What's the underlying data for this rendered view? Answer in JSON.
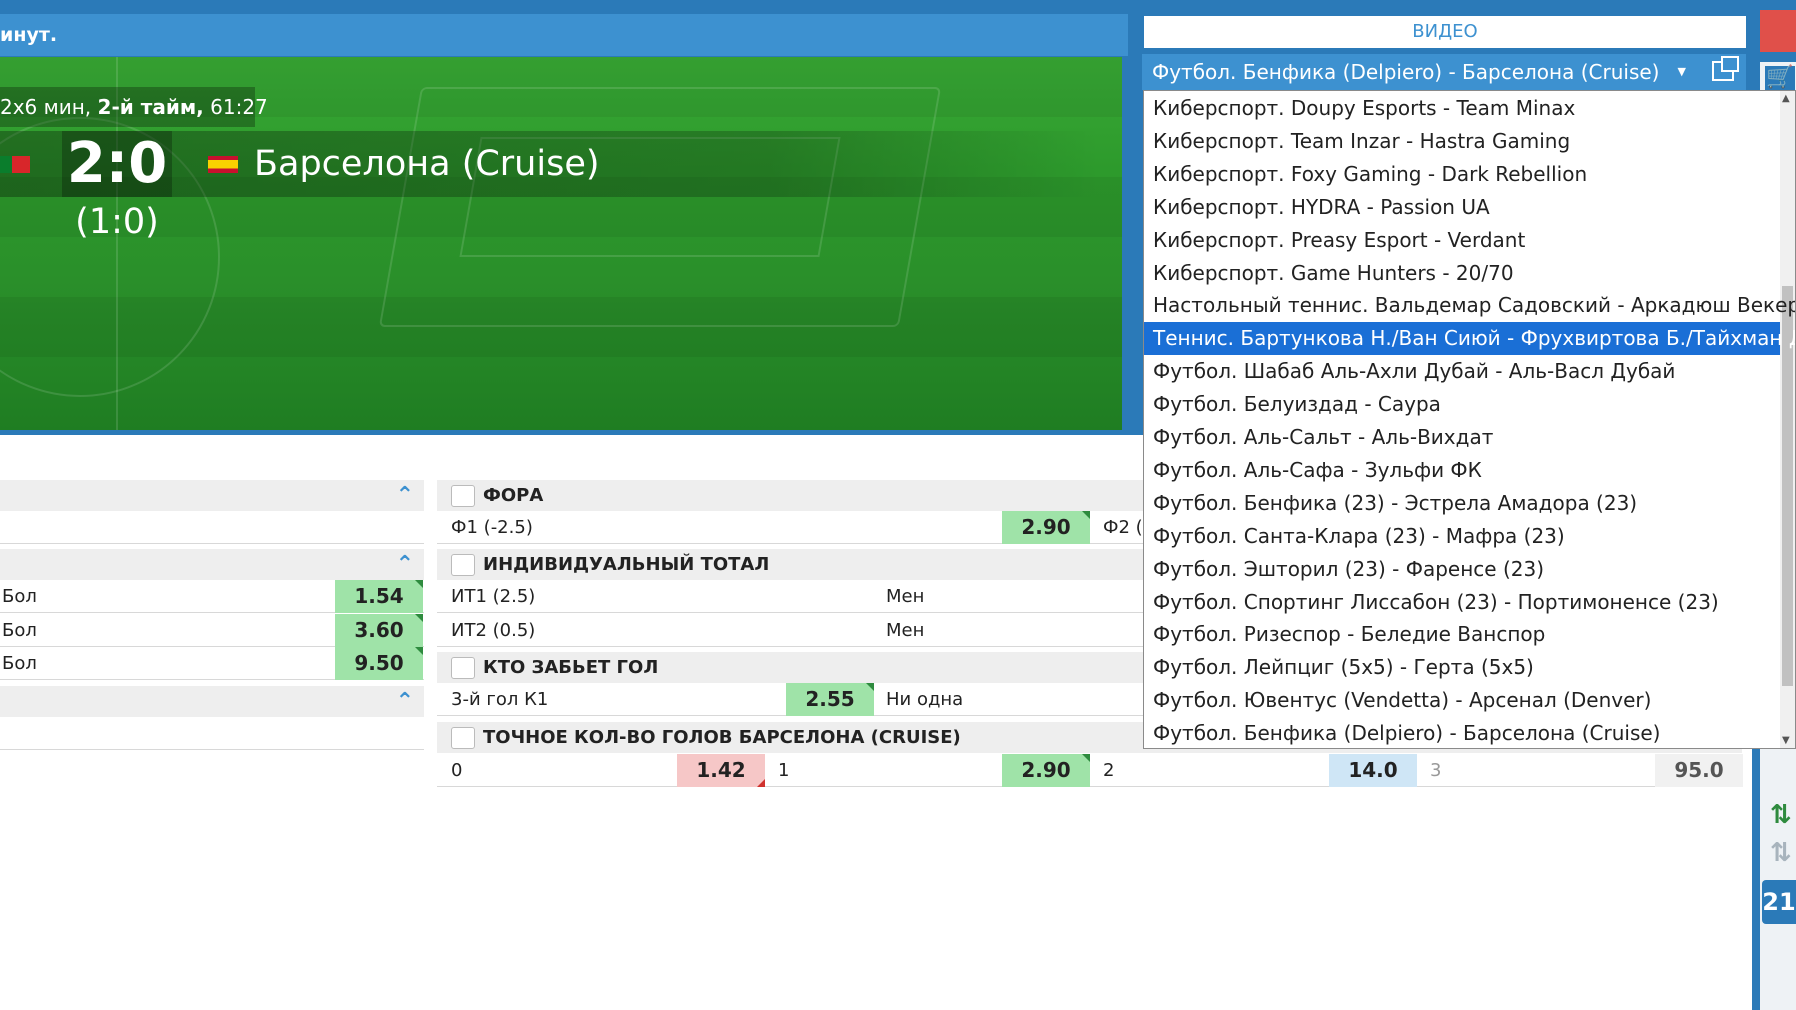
{
  "game": {
    "header_text": "инут.",
    "time_prefix": "2х6 мин, ",
    "half": "2-й тайм,",
    "clock": " 61:27",
    "score": "2:0",
    "team2": "Барселона (Cruise)",
    "halftime_score": "(1:0)"
  },
  "video": {
    "title": "ВИДЕО",
    "selected": "Футбол. Бенфика (Delpiero) - Барселона (Cruise)",
    "caret": "▼",
    "items": [
      "Киберспорт. Doupy Esports - Team Minax",
      "Киберспорт. Team Inzar - Hastra Gaming",
      "Киберспорт. Foxy Gaming - Dark Rebellion",
      "Киберспорт. HYDRA - Passion UA",
      "Киберспорт. Preasy Esport - Verdant",
      "Киберспорт. Game Hunters - 20/70",
      "Настольный теннис. Вальдемар Садовский - Аркадюш Векера",
      "Теннис. Бартункова Н./Ван Сиюй - Фрухвиртова Б./Тайхман Дж.",
      "Футбол. Шабаб Аль-Ахли Дубай - Аль-Васл Дубай",
      "Футбол. Белуиздад - Саура",
      "Футбол. Аль-Сальт - Аль-Вихдат",
      "Футбол. Аль-Сафа - Зульфи ФК",
      "Футбол. Бенфика (23) - Эстрела Амадора (23)",
      "Футбол. Санта-Клара (23) - Мафра (23)",
      "Футбол. Эшторил (23) - Фаренсе (23)",
      "Футбол. Спортинг Лиссабон (23) - Портимоненсе (23)",
      "Футбол. Ризеспор - Беледие Ванспор",
      "Футбол. Лейпциг (5х5) - Герта (5х5)",
      "Футбол. Ювентус (Vendetta) - Арсенал (Denver)",
      "Футбол. Бенфика (Delpiero) - Барселона (Cruise)"
    ],
    "selected_index": 7
  },
  "left": {
    "rows": [
      {
        "label": "Бол",
        "odd": "1.54"
      },
      {
        "label": "Бол",
        "odd": "3.60"
      },
      {
        "label": "Бол",
        "odd": "9.50"
      }
    ]
  },
  "fora": {
    "title": "ФОРА",
    "f1_label": "Ф1 (-2.5)",
    "f1_odd": "2.90",
    "f2_label": "Ф2 ("
  },
  "ind_total": {
    "title": "ИНДИВИДУАЛЬНЫЙ ТОТАЛ",
    "rows": [
      {
        "label": "ИТ1 (2.5)",
        "under": "Мен"
      },
      {
        "label": "ИТ2 (0.5)",
        "under": "Мен"
      }
    ]
  },
  "who_scores": {
    "title": "КТО ЗАБЬЕТ ГОЛ",
    "label": "3-й гол К1",
    "odd": "2.55",
    "label2": "Ни одна"
  },
  "exact_goals": {
    "title": "ТОЧНОЕ КОЛ-ВО ГОЛОВ БАРСЕЛОНА (CRUISE)",
    "cells": [
      {
        "n": "0",
        "odd": "1.42"
      },
      {
        "n": "1",
        "odd": "2.90"
      },
      {
        "n": "2",
        "odd": "14.0"
      },
      {
        "n": "3",
        "odd": "95.0"
      }
    ]
  },
  "sidebar": {
    "badge": "21",
    "cart_icon": "cart-icon",
    "arrow_green": "⇅",
    "arrow_grey": "⇅"
  },
  "colors": {
    "header_blue": "#3d91d0",
    "frame_blue": "#2b7ab8",
    "odd_green": "#9fe3a8",
    "odd_pink": "#f6c7c7",
    "odd_blue": "#cfe6f6",
    "select_blue": "#1a6fd6"
  }
}
